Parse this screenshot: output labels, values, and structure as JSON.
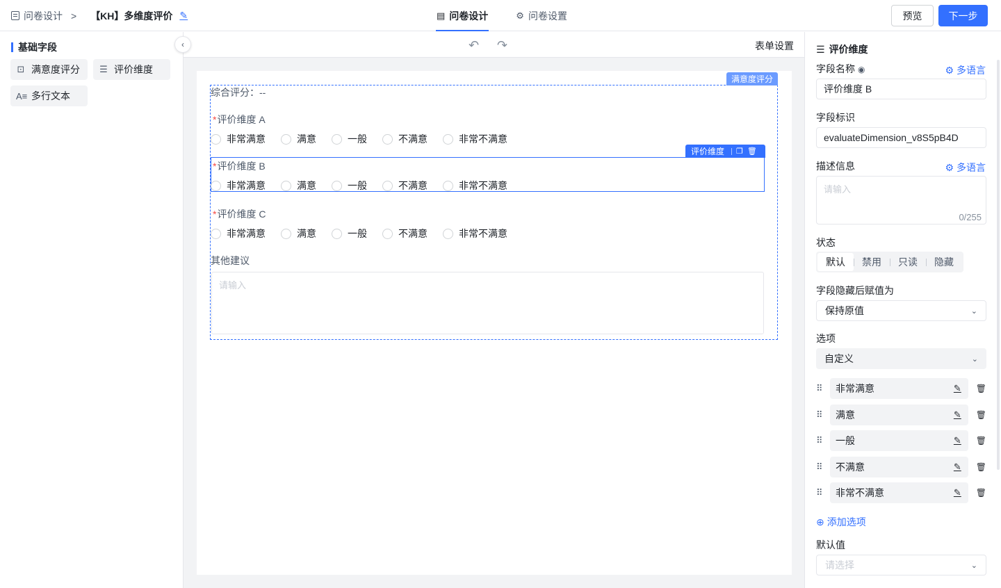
{
  "header": {
    "breadcrumb_root": "问卷设计",
    "breadcrumb_sep": ">",
    "title": "【KH】多维度评价",
    "tabs": [
      {
        "label": "问卷设计",
        "icon": "document-icon",
        "active": true
      },
      {
        "label": "问卷设置",
        "icon": "gear-icon",
        "active": false
      }
    ],
    "preview_label": "预览",
    "next_label": "下一步",
    "accent_color": "#3370ff"
  },
  "left_panel": {
    "section_title": "基础字段",
    "fields": [
      {
        "label": "满意度评分",
        "icon": "rating-icon"
      },
      {
        "label": "评价维度",
        "icon": "list-icon"
      },
      {
        "label": "多行文本",
        "icon": "text-icon"
      }
    ]
  },
  "canvas": {
    "form_settings_label": "表单设置",
    "group_tag": "满意度评分",
    "summary": "综合评分：--",
    "dimensions": [
      {
        "label": "评价维度 A",
        "required": true,
        "selected": false
      },
      {
        "label": "评价维度 B",
        "required": true,
        "selected": true
      },
      {
        "label": "评价维度 C",
        "required": true,
        "selected": false
      }
    ],
    "options": [
      "非常满意",
      "满意",
      "一般",
      "不满意",
      "非常不满意"
    ],
    "selected_tag": "评价维度",
    "other_label": "其他建议",
    "other_placeholder": "请输入"
  },
  "right_panel": {
    "title": "评价维度",
    "field_name_label": "字段名称",
    "multilang_label": "多语言",
    "field_name_value": "评价维度 B",
    "field_id_label": "字段标识",
    "field_id_value": "evaluateDimension_v8S5pB4D",
    "desc_label": "描述信息",
    "desc_placeholder": "请输入",
    "desc_counter": "0/255",
    "status_label": "状态",
    "status_options": [
      "默认",
      "禁用",
      "只读",
      "隐藏"
    ],
    "status_selected": "默认",
    "hidden_value_label": "字段隐藏后赋值为",
    "hidden_value": "保持原值",
    "options_label": "选项",
    "options_mode": "自定义",
    "option_items": [
      "非常满意",
      "满意",
      "一般",
      "不满意",
      "非常不满意"
    ],
    "add_option_label": "添加选项",
    "default_label": "默认值",
    "default_placeholder": "请选择"
  }
}
